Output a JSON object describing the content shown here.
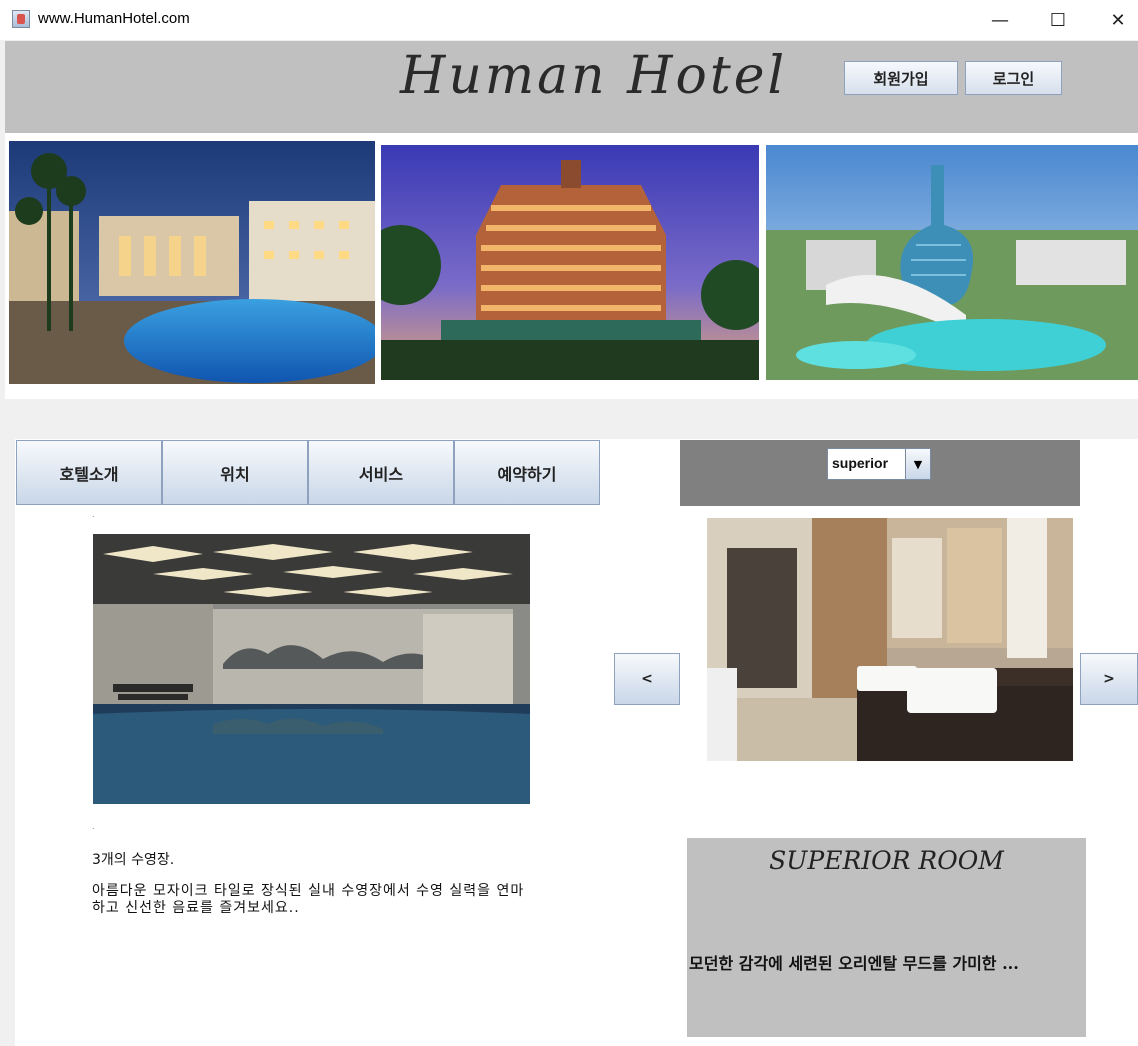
{
  "window": {
    "title": "www.HumanHotel.com",
    "controls": {
      "minimize": "—",
      "maximize": "☐",
      "close": "✕"
    }
  },
  "header": {
    "title": "Human Hotel",
    "signup_label": "회원가입",
    "login_label": "로그인"
  },
  "nav": {
    "items": [
      {
        "label": "호텔소개"
      },
      {
        "label": "위치"
      },
      {
        "label": "서비스"
      },
      {
        "label": "예약하기"
      }
    ]
  },
  "feature": {
    "title": "3개의 수영장.",
    "description": "아름다운 모자이크 타일로 장식된 실내 수영장에서 수영 실력을 연마하고 신선한 음료를 즐겨보세요.."
  },
  "room": {
    "selected_type": "superior",
    "prev_label": "<",
    "next_label": ">",
    "card_title": "SUPERIOR ROOM",
    "card_desc": "모던한 감각에 세련된 오리엔탈 무드를 가미한 ..."
  },
  "colors": {
    "header_bg": "#c0c0c0",
    "panel_dark": "#808080",
    "button_border": "#8ea2bd"
  }
}
